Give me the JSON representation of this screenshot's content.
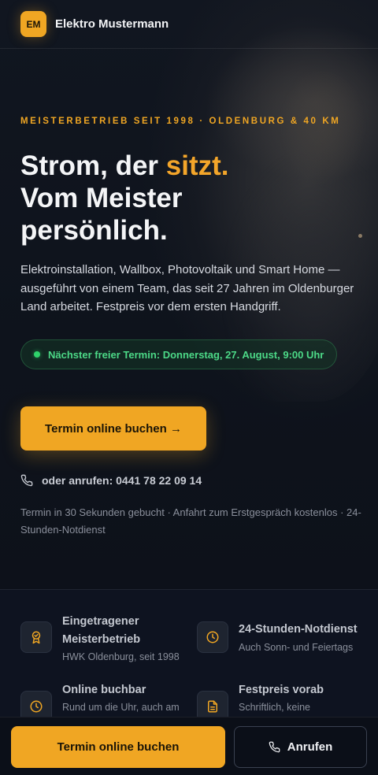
{
  "header": {
    "logo_initials": "EM",
    "brand_name": "Elektro Mustermann"
  },
  "hero": {
    "eyebrow": "MEISTERBETRIEB SEIT 1998 · OLDENBURG & 40 KM",
    "headline_part1": "Strom, der ",
    "headline_accent": "sitzt.",
    "headline_line2": "Vom Meister",
    "headline_line3": "persönlich.",
    "lead": "Elektroinstallation, Wallbox, Photovoltaik und Smart Home — ausgeführt von einem Team, das seit 27 Jahren im Oldenburger Land arbeitet. Festpreis vor dem ersten Handgriff.",
    "availability_badge": "Nächster freier Termin: Donnerstag, 27. August, 9:00 Uhr",
    "cta_label": "Termin online buchen →",
    "phone_label": "oder anrufen: 0441 78 22 09 14",
    "meta": "Termin in 30 Sekunden gebucht · Anfahrt zum Erstgespräch kostenlos · 24-Stunden-Notdienst"
  },
  "features": [
    {
      "icon": "award-icon",
      "title": "Eingetragener Meisterbetrieb",
      "subtitle": "HWK Oldenburg, seit 1998"
    },
    {
      "icon": "clock-icon",
      "title": "24-Stunden-Notdienst",
      "subtitle": "Auch Sonn- und Feiertags"
    },
    {
      "icon": "clock-icon",
      "title": "Online buchbar",
      "subtitle": "Rund um die Uhr, auch am"
    },
    {
      "icon": "document-icon",
      "title": "Festpreis vorab",
      "subtitle": "Schriftlich, keine"
    }
  ],
  "bottom_bar": {
    "primary_label": "Termin online buchen",
    "secondary_label": "Anrufen"
  },
  "colors": {
    "accent": "#f0a623",
    "background": "#0c1019",
    "success": "#2fd36b"
  }
}
